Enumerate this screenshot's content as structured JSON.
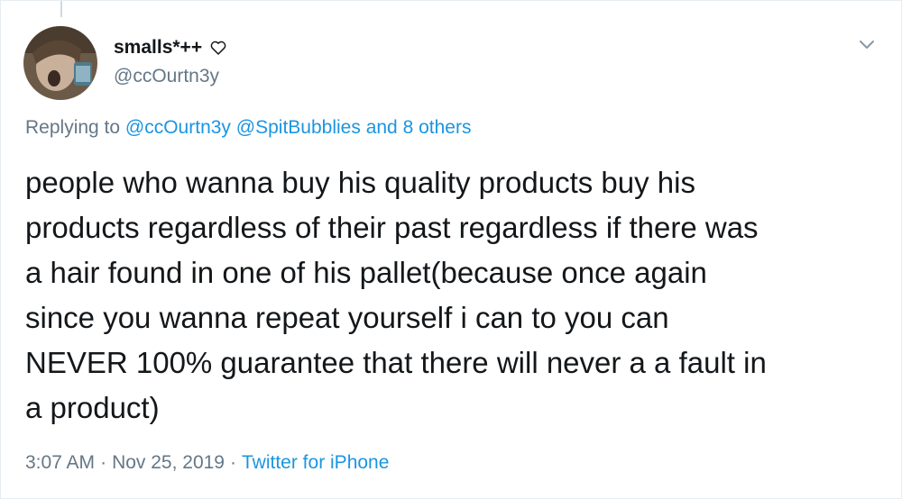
{
  "tweet": {
    "author": {
      "display_name": "smalls*++",
      "handle": "@ccOurtn3y",
      "avatar_icon": "avatar-photo",
      "name_icon": "heart-outline-icon"
    },
    "menu_icon": "chevron-down-icon",
    "reply": {
      "prefix": "Replying to",
      "mentions": [
        "@ccOurtn3y",
        "@SpitBubblies"
      ],
      "connector": "and",
      "others": "8 others"
    },
    "text_lines": [
      "people who wanna buy his quality products buy his",
      "products regardless of their past regardless if there was",
      "a hair found in one of his pallet(because once again",
      "since you wanna repeat yourself i can to you can",
      "NEVER 100% guarantee that there will never a a fault in",
      "a product)"
    ],
    "time": "3:07 AM",
    "date": "Nov 25, 2019",
    "separator": "·",
    "source": "Twitter for iPhone"
  },
  "colors": {
    "text": "#14171a",
    "secondary": "#657786",
    "link": "#1b95e0",
    "border": "#e6ecf0"
  }
}
